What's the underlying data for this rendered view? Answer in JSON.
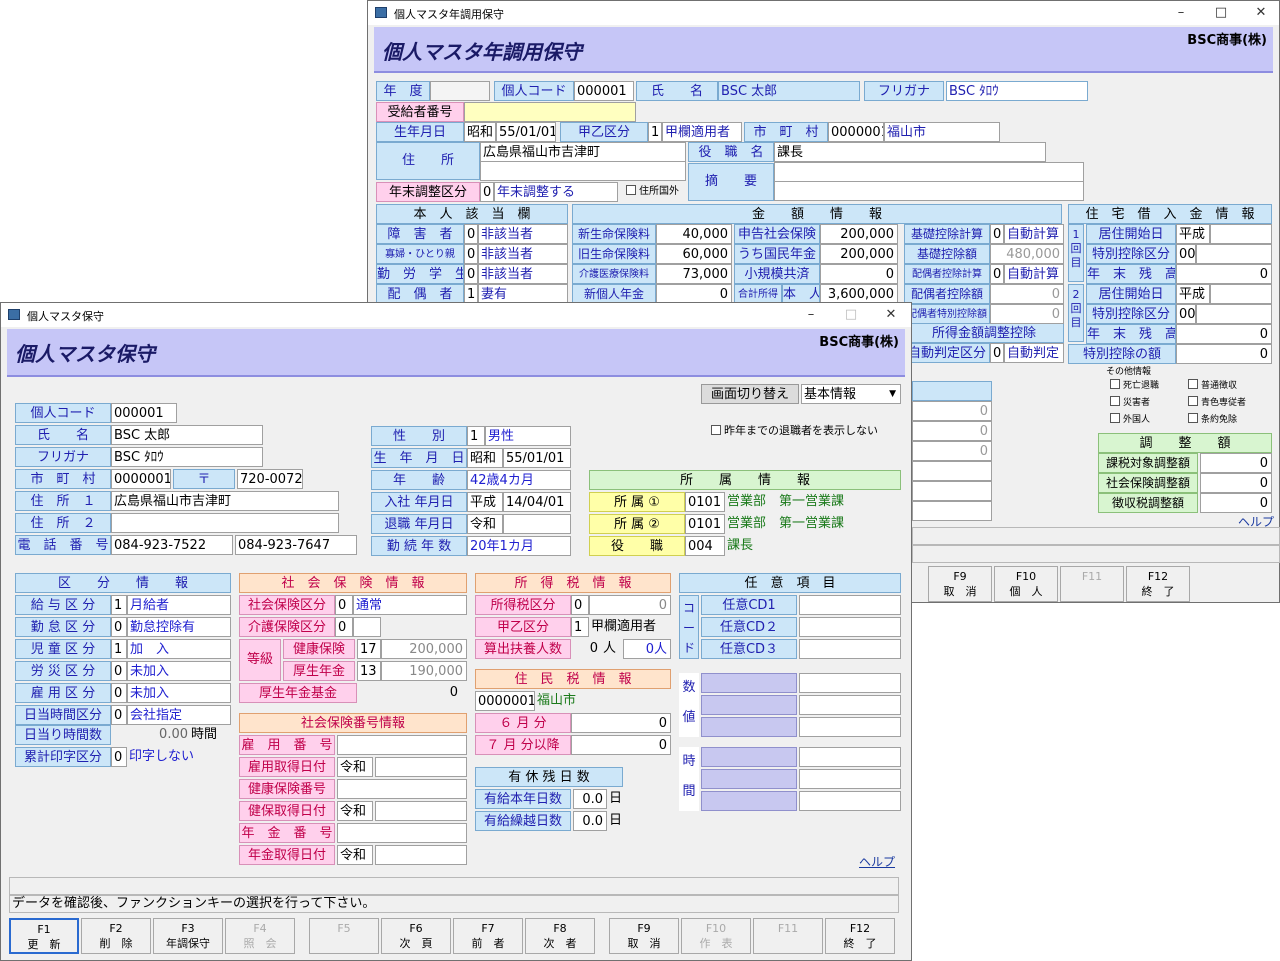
{
  "back": {
    "title": "個人マスタ年調用保守",
    "banner": "個人マスタ年調用保守",
    "company": "BSC商事(株)",
    "rows": {
      "nendo_l": "年　度",
      "kojin_l": "個人コード",
      "kojin_v": "000001",
      "shimei_l": "氏　　名",
      "shimei_v": "BSC 太郎",
      "furi_l": "フリガナ",
      "furi_v": "BSC ﾀﾛｳ",
      "jukyu_l": "受給者番号",
      "seinen_l": "生年月日",
      "seinen_e": "昭和",
      "seinen_v": "55/01/01",
      "kouotsu_l": "甲乙区分",
      "kouotsu_n": "1",
      "kouotsu_v": "甲欄適用者",
      "shi_l": "市　町　村",
      "shi_c": "0000001",
      "shi_v": "福山市",
      "jusho_l": "住　　所",
      "jusho_v": "広島県福山市吉津町",
      "yaku_l": "役　職　名",
      "yaku_v": "課長",
      "teki_l": "摘　　要",
      "nenmatsu_l": "年末調整区分",
      "nenmatsu_n": "0",
      "nenmatsu_v": "年末調整する",
      "kokugai": "住所国外"
    },
    "honnin": {
      "header": "本　人　該　当　欄",
      "rows": [
        {
          "l": "障　害　者",
          "n": "0",
          "v": "非該当者"
        },
        {
          "l": "寡婦・ひとり親",
          "n": "0",
          "v": "非該当者"
        },
        {
          "l": "勤　労　学　生",
          "n": "0",
          "v": "非該当者"
        },
        {
          "l": "配　偶　者",
          "n": "1",
          "v": "妻有"
        }
      ]
    },
    "kingaku": {
      "header": "金　　額　　情　　報",
      "a": [
        {
          "l": "新生命保険料",
          "v": "40,000"
        },
        {
          "l": "旧生命保険料",
          "v": "60,000"
        },
        {
          "l": "介護医療保険料",
          "v": "73,000"
        },
        {
          "l": "新個人年金",
          "v": "0"
        }
      ],
      "b": [
        {
          "l": "申告社会保険",
          "v": "200,000"
        },
        {
          "l": "うち国民年金",
          "v": "200,000"
        },
        {
          "l": "小規模共済",
          "v": "0"
        },
        {
          "l": "合計所得",
          "l2": "本　人",
          "v": "3,600,000"
        }
      ],
      "c": [
        {
          "l": "基礎控除計算",
          "n": "0",
          "v": "自動計算"
        },
        {
          "l": "基礎控除額",
          "v": "480,000"
        },
        {
          "l": "配偶者控除計算",
          "n": "0",
          "v": "自動計算"
        },
        {
          "l": "配偶者控除額",
          "v": "0"
        },
        {
          "l": "配偶者特別控除額",
          "v": "0"
        }
      ],
      "shotoku": "所得金額調整控除",
      "jidou_l": "自動判定区分",
      "jidou_n": "0",
      "jidou_v": "自動判定"
    },
    "jutaku": {
      "header": "住　宅　借　入　金　情　報",
      "k1": "1回目",
      "k2": "2回目",
      "kaishi_l": "居住開始日",
      "kaishi_v": "平成",
      "tokubetsu_l": "特別控除区分",
      "tokubetsu_v": "00",
      "zandaka_l": "年　末　残　高",
      "zandaka_v": "0",
      "kaishi2_v": "平成",
      "tokubetsu2_v": "00",
      "zandaka2_v": "0",
      "gaku_l": "特別控除の額",
      "gaku_v": "0"
    },
    "sonota": {
      "header": "その他情報",
      "items": [
        "死亡退職",
        "普通徴収",
        "災害者",
        "青色専従者",
        "外国人",
        "条約免除"
      ]
    },
    "chosei": {
      "header": "調　　整　　額",
      "rows": [
        {
          "l": "課税対象調整額",
          "v": "0"
        },
        {
          "l": "社会保険調整額",
          "v": "0"
        },
        {
          "l": "徴収税調整額",
          "v": "0"
        }
      ]
    },
    "mid_vals": [
      "0",
      "0",
      "0"
    ],
    "help": "ヘルプ",
    "fkeys": [
      {
        "k": "F9",
        "l": "取　消"
      },
      {
        "k": "F10",
        "l": "個　人"
      },
      {
        "k": "F11",
        "l": ""
      },
      {
        "k": "F12",
        "l": "終　了"
      }
    ]
  },
  "front": {
    "title": "個人マスタ保守",
    "banner": "個人マスタ保守",
    "company": "BSC商事(株)",
    "switch_label": "画面切り替え",
    "switch_value": "基本情報",
    "hide_retired": "昨年までの退職者を表示しない",
    "kojin_l": "個人コード",
    "kojin_v": "000001",
    "shimei_l": "氏　　名",
    "shimei_v": "BSC 太郎",
    "furi_l": "フリガナ",
    "furi_v": "BSC ﾀﾛｳ",
    "shi_l": "市　町　村",
    "shi_c": "0000001",
    "post_l": "〒",
    "post_v": "720-0072",
    "jusho1_l": "住　所　１",
    "jusho1_v": "広島県福山市吉津町",
    "jusho2_l": "住　所　２",
    "jusho2_v": "",
    "tel_l": "電　話　番　号",
    "tel1": "084-923-7522",
    "tel2": "084-923-7647",
    "sei_l": "性　　別",
    "sei_n": "1",
    "sei_v": "男性",
    "seinen_l": "生　年　月　日",
    "seinen_e": "昭和",
    "seinen_v": "55/01/01",
    "nenrei_l": "年　　齢",
    "nenrei_v": "42歳4カ月",
    "nyusha_l": "入社 年月日",
    "nyusha_e": "平成",
    "nyusha_v": "14/04/01",
    "taishoku_l": "退職 年月日",
    "taishoku_e": "令和",
    "taishoku_v": "",
    "kinzoku_l": "勤 続 年 数",
    "kinzoku_v": "20年1カ月",
    "shozoku": {
      "header": "所　　属　　情　　報",
      "r1_l": "所 属 ①",
      "r1_c": "0101",
      "r1_v": "営業部　第一営業課",
      "r2_l": "所 属 ②",
      "r2_c": "0101",
      "r2_v": "営業部　第一営業課",
      "r3_l": "役　　職",
      "r3_c": "004",
      "r3_v": "課長"
    },
    "kubun": {
      "header": "区　　分　　情　　報",
      "rows": [
        {
          "l": "給 与 区 分",
          "n": "1",
          "v": "月給者"
        },
        {
          "l": "勤 怠 区 分",
          "n": "0",
          "v": "勤怠控除有"
        },
        {
          "l": "児 童 区 分",
          "n": "1",
          "v": "加　入"
        },
        {
          "l": "労 災 区 分",
          "n": "0",
          "v": "未加入"
        },
        {
          "l": "雇 用 区 分",
          "n": "0",
          "v": "未加入"
        },
        {
          "l": "日当時間区分",
          "n": "0",
          "v": "会社指定"
        }
      ],
      "jikan_l": "日当り時間数",
      "jikan_v": "0.00",
      "jikan_u": "時間",
      "ruikei_l": "累計印字区分",
      "ruikei_n": "0",
      "ruikei_v": "印字しない"
    },
    "shaho": {
      "header": "社　会　保　険　情　報",
      "shaho_l": "社会保険区分",
      "shaho_n": "0",
      "shaho_v": "通常",
      "kaigo_l": "介護保険区分",
      "kaigo_n": "0",
      "tokyu_l": "等級",
      "kenpo_l": "健康保険",
      "kenpo_n": "17",
      "kenpo_v": "200,000",
      "kosei_l": "厚生年金",
      "kosei_n": "13",
      "kosei_v": "190,000",
      "kikin_l": "厚生年金基金",
      "kikin_v": "0"
    },
    "bango": {
      "header": "社会保険番号情報",
      "rows": [
        {
          "l": "雇　用　番　号",
          "e": "",
          "v": ""
        },
        {
          "l": "雇用取得日付",
          "e": "令和",
          "v": ""
        },
        {
          "l": "健康保険番号",
          "e": "",
          "v": ""
        },
        {
          "l": "健保取得日付",
          "e": "令和",
          "v": ""
        },
        {
          "l": "年　金　番　号",
          "e": "",
          "v": ""
        },
        {
          "l": "年金取得日付",
          "e": "令和",
          "v": ""
        }
      ]
    },
    "shotoku": {
      "header": "所　得　税　情　報",
      "kubun_l": "所得税区分",
      "kubun_n": "0",
      "kubun_v": "0",
      "kouotsu_l": "甲乙区分",
      "kouotsu_n": "1",
      "kouotsu_v": "甲欄適用者",
      "fuyo_l": "算出扶養人数",
      "fuyo_n": "0",
      "fuyo_u": "人",
      "fuyo_v": "0人"
    },
    "jumin": {
      "header": "住　民　税　情　報",
      "code": "0000001",
      "city": "福山市",
      "r6_l": "６ 月 分",
      "r6_v": "0",
      "r7_l": "７ 月 分以降",
      "r7_v": "0"
    },
    "yukyu": {
      "header": "有 休 残 日 数",
      "r1_l": "有給本年日数",
      "r1_v": "0.0",
      "r2_l": "有給繰越日数",
      "r2_v": "0.0",
      "u": "日"
    },
    "nini": {
      "header": "任　意　項　目",
      "code_l": "コード",
      "code_rows": [
        "任意CD1",
        "任意CD２",
        "任意CD３"
      ],
      "suchi_l": "数値",
      "jikan_l": "時間"
    },
    "help": "ヘルプ",
    "status": "データを確認後、ファンクションキーの選択を行って下さい。",
    "fkeys": [
      {
        "k": "F1",
        "l": "更　新"
      },
      {
        "k": "F2",
        "l": "削　除"
      },
      {
        "k": "F3",
        "l": "年調保守"
      },
      {
        "k": "F4",
        "l": "照　会"
      },
      {
        "k": "F5",
        "l": ""
      },
      {
        "k": "F6",
        "l": "次　頁"
      },
      {
        "k": "F7",
        "l": "前　者"
      },
      {
        "k": "F8",
        "l": "次　者"
      },
      {
        "k": "F9",
        "l": "取　消"
      },
      {
        "k": "F10",
        "l": "作　表"
      },
      {
        "k": "F11",
        "l": ""
      },
      {
        "k": "F12",
        "l": "終　了"
      }
    ]
  }
}
